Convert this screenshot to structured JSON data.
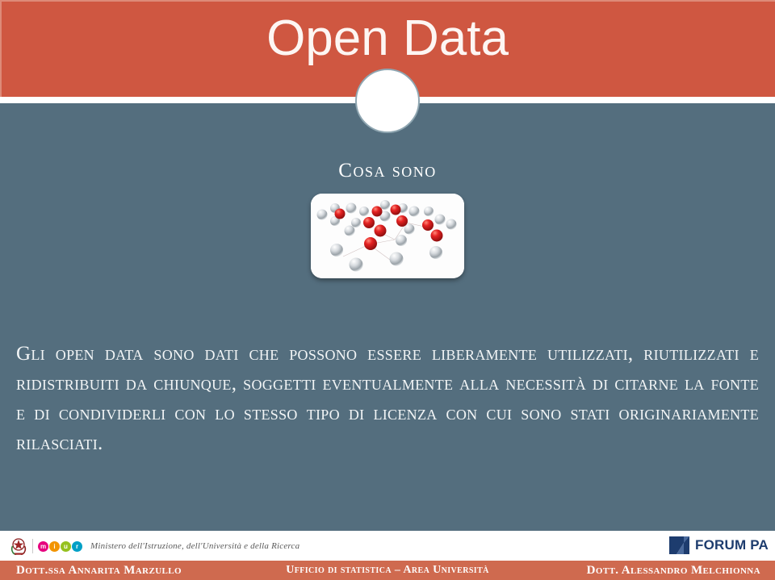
{
  "slide": {
    "title": "Open Data",
    "section_heading": "Cosa sono",
    "body_text": "Gli open data sono dati che possono essere liberamente utilizzati, riutilizzati e ridistribuiti da chiunque, soggetti eventualmente alla necessità di citarne la fonte e di condividerli con lo stesso tipo di licenza con cui sono stati originariamente rilasciati."
  },
  "colors": {
    "accent_orange": "#cf5741",
    "footer_orange": "#cf6a4f",
    "body_slate": "#546e7e",
    "title_white": "#fdf6f3",
    "forumpa_blue": "#1d3c6e"
  },
  "illustration": {
    "name": "linked-spheres-graphic",
    "red_color": "#d81f1f",
    "chrome_color": "#c9cdd1",
    "background": "#fdfdfd"
  },
  "footer": {
    "miur": {
      "emblem_name": "italian-republic-emblem",
      "dots": [
        {
          "letter": "m",
          "color": "#e6007e"
        },
        {
          "letter": "i",
          "color": "#f29400"
        },
        {
          "letter": "u",
          "color": "#95c11f"
        },
        {
          "letter": "r",
          "color": "#00a0c6"
        }
      ],
      "wordmark": "Ministero dell'Istruzione, dell'Università e della Ricerca"
    },
    "forum_pa": {
      "mark_name": "forum-pa-logo-mark",
      "text": "FORUM PA"
    },
    "bar": {
      "left": "Dott.ssa Annarita Marzullo",
      "center": "Ufficio di statistica – Area Università",
      "right": "Dott. Alessandro Melchionna"
    }
  }
}
